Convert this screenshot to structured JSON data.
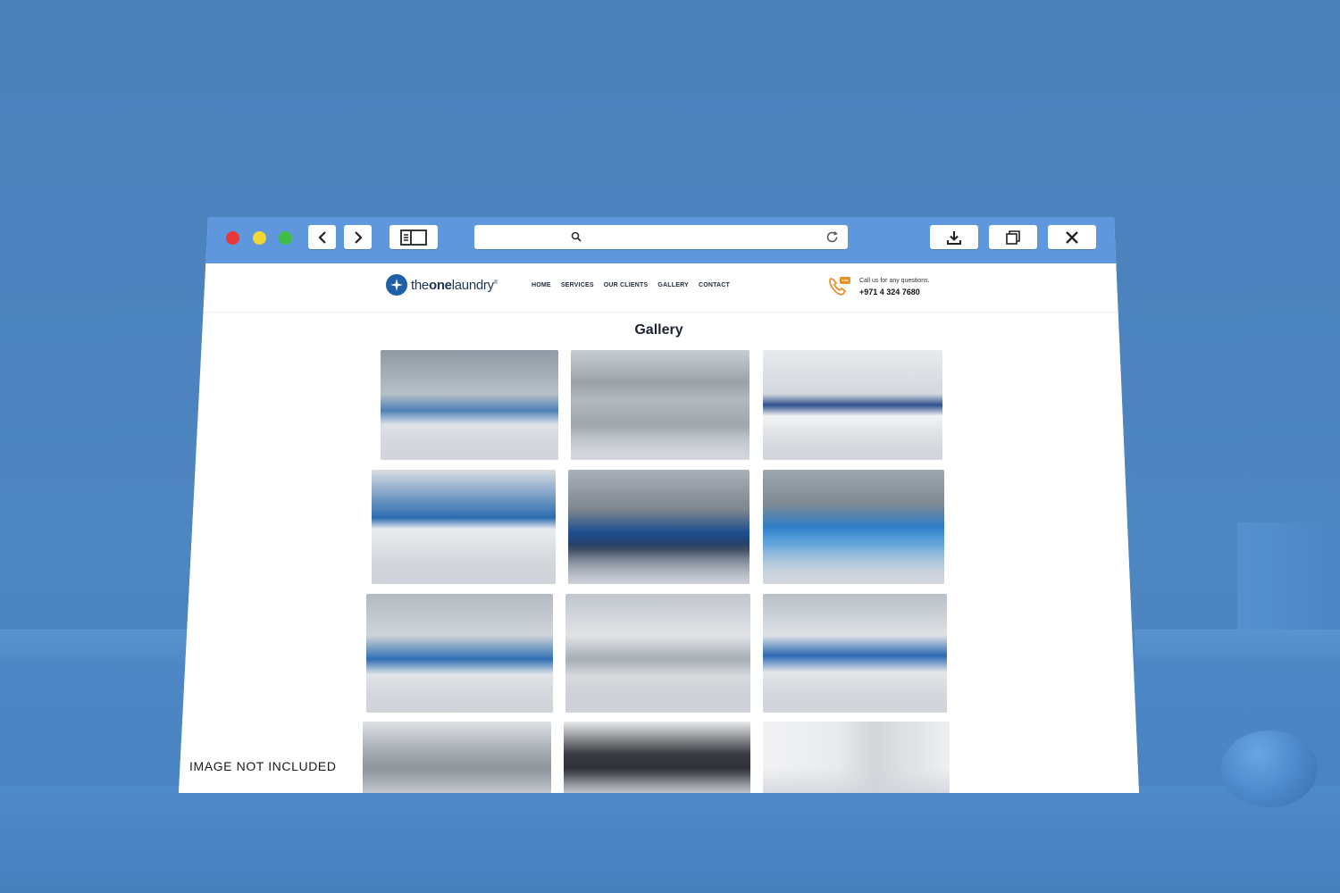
{
  "browser": {
    "controls": {
      "back": "back",
      "forward": "forward",
      "sidebar": "sidebar",
      "reload": "reload",
      "download": "download",
      "duplicate": "duplicate",
      "close": "close"
    }
  },
  "site": {
    "logo": {
      "prefix": "the",
      "bold": "one",
      "suffix": "laundry",
      "mark": "®"
    },
    "nav": [
      "HOME",
      "SERVICES",
      "OUR CLIENTS",
      "GALLERY",
      "CONTACT"
    ],
    "call": {
      "line1": "Call us for any questions.",
      "phone": "+971 4 324 7680"
    }
  },
  "gallery": {
    "title": "Gallery",
    "photos": [
      "ironer-machine-photo",
      "washer-row-photo",
      "pressing-stations-photo",
      "folder-machine-photo",
      "delivery-vans-photo",
      "blue-ironer-photo",
      "flatwork-ironer-photo",
      "feeder-machine-photo",
      "laundry-hall-photo",
      "industrial-washers-photo",
      "garment-press-photo",
      "shirt-handling-photo"
    ]
  },
  "overlay": {
    "note": "IMAGE NOT INCLUDED"
  },
  "colors": {
    "scene": "#4e86c2",
    "titlebar": "#5e97dc",
    "brand": "#1e5fa8"
  }
}
